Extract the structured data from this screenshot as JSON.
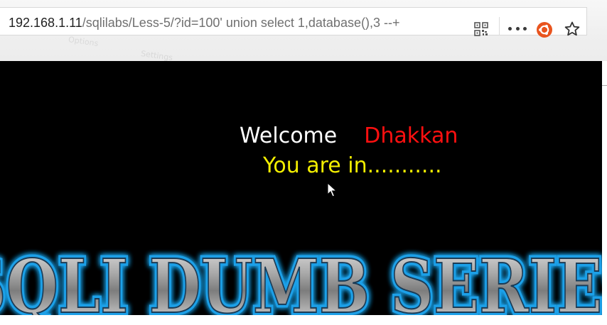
{
  "browser": {
    "url_host": "192.168.1.11",
    "url_path": "/sqlilabs/Less-5/?id=100' union select 1,database(),3 --+",
    "icons": {
      "qr": "qr-code-icon",
      "more": "more-options-icon",
      "extension": "ubuntu-extension-icon",
      "bookmark": "bookmark-star-icon"
    },
    "ghost_texts": [
      "Options",
      "Settings"
    ]
  },
  "page": {
    "welcome": "Welcome",
    "name": "Dhakkan",
    "status": "You are in...........",
    "banner": "SQLI DUMB SERIES"
  },
  "colors": {
    "background": "#000000",
    "welcome": "#ffffff",
    "name": "#ff1010",
    "status": "#f3ef00",
    "banner_glow": "#1ea0e8"
  }
}
